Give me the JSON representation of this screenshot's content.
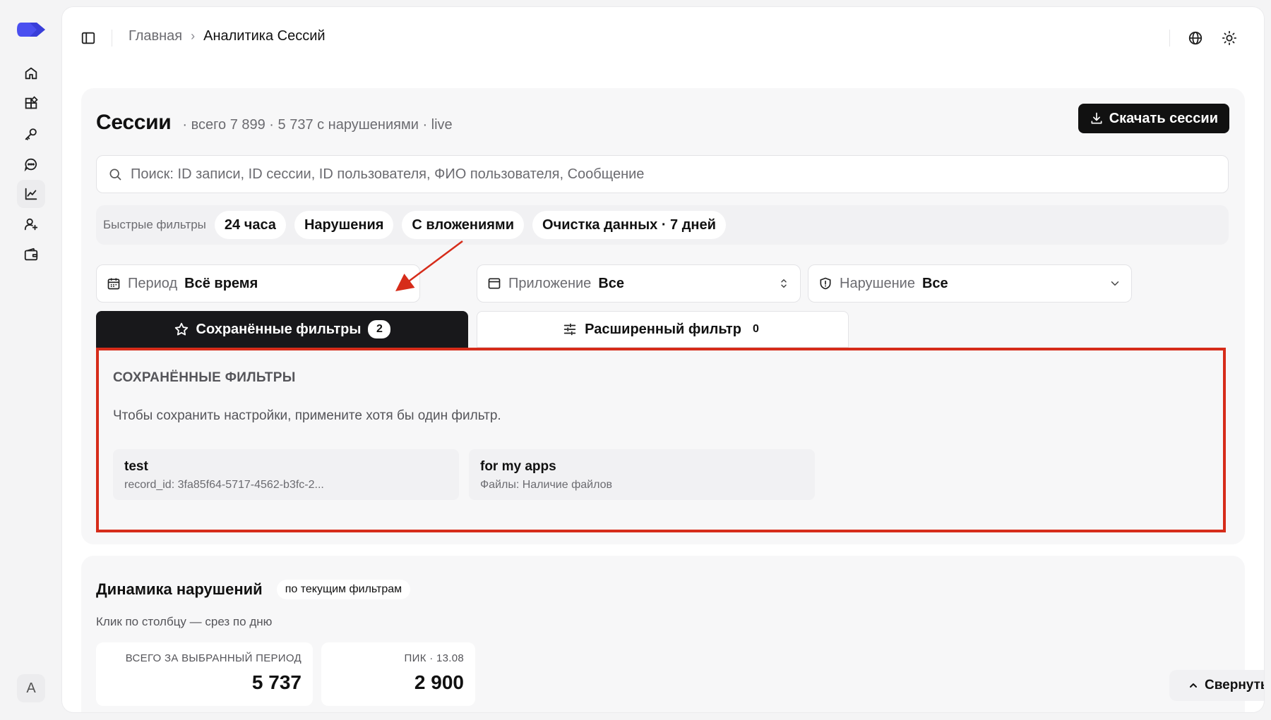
{
  "rail": {
    "items": [
      "home-icon",
      "widgets-icon",
      "key-icon",
      "chat-icon",
      "analytics-icon",
      "user-add-icon",
      "wallet-icon"
    ],
    "active_index": 4,
    "avatar_letter": "A"
  },
  "breadcrumb": {
    "home": "Главная",
    "current": "Аналитика Сессий"
  },
  "header": {
    "title": "Сессии",
    "subtitle": "· всего 7 899 · 5 737 с нарушениями · live",
    "download_label": "Скачать сессии"
  },
  "search": {
    "placeholder": "Поиск: ID записи, ID сессии, ID пользователя, ФИО пользователя, Сообщение"
  },
  "quick_filters": {
    "label": "Быстрые фильтры",
    "chips": [
      "24 часа",
      "Нарушения",
      "С вложениями",
      "Очистка данных · 7 дней"
    ]
  },
  "selects": {
    "period": {
      "label": "Период",
      "value": "Всё время"
    },
    "app": {
      "label": "Приложение",
      "value": "Все"
    },
    "violation": {
      "label": "Нарушение",
      "value": "Все"
    }
  },
  "tabs": {
    "saved": {
      "label": "Сохранённые фильтры",
      "count": "2"
    },
    "advanced": {
      "label": "Расширенный фильтр",
      "count": "0"
    }
  },
  "saved_filters": {
    "title": "СОХРАНЁННЫЕ ФИЛЬТРЫ",
    "hint": "Чтобы сохранить настройки, примените хотя бы один фильтр.",
    "items": [
      {
        "name": "test",
        "desc": "record_id: 3fa85f64-5717-4562-b3fc-2..."
      },
      {
        "name": "for my apps",
        "desc": "Файлы: Наличие файлов"
      }
    ]
  },
  "dynamics": {
    "title": "Динамика нарушений",
    "chip": "по текущим фильтрам",
    "hint": "Клик по столбцу — срез по дню",
    "stats": [
      {
        "label": "ВСЕГО ЗА ВЫБРАННЫЙ ПЕРИОД",
        "value": "5 737"
      },
      {
        "label": "ПИК · 13.08",
        "value": "2 900"
      }
    ],
    "collapse_label": "Свернуть"
  },
  "colors": {
    "accent": "#4a4ff0",
    "highlight": "#d62c1a",
    "dark": "#18181b"
  }
}
